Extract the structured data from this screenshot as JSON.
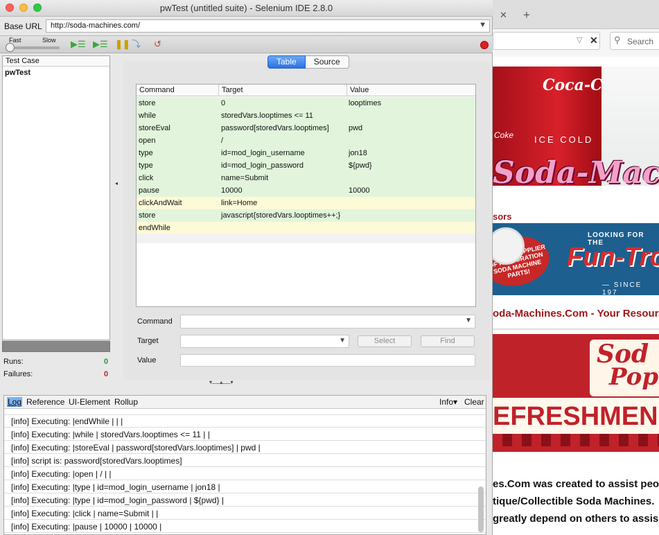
{
  "window": {
    "title": "pwTest (untitled suite) - Selenium IDE 2.8.0"
  },
  "base_url": {
    "label": "Base URL",
    "value": "http://soda-machines.com/"
  },
  "speed": {
    "fast_label": "Fast",
    "slow_label": "Slow"
  },
  "test_case_panel": {
    "header": "Test Case",
    "items": [
      "pwTest"
    ]
  },
  "stats": {
    "runs_label": "Runs:",
    "runs_value": "0",
    "failures_label": "Failures:",
    "failures_value": "0"
  },
  "tabs": {
    "table": "Table",
    "source": "Source"
  },
  "grid": {
    "headers": [
      "Command",
      "Target",
      "Value"
    ],
    "rows": [
      {
        "command": "store",
        "target": "0",
        "value": "looptimes"
      },
      {
        "command": "while",
        "target": "storedVars.looptimes <= 11",
        "value": ""
      },
      {
        "command": "storeEval",
        "target": "password[storedVars.looptimes]",
        "value": "pwd"
      },
      {
        "command": "open",
        "target": "/",
        "value": ""
      },
      {
        "command": "type",
        "target": "id=mod_login_username",
        "value": "jon18"
      },
      {
        "command": "type",
        "target": "id=mod_login_password",
        "value": "${pwd}"
      },
      {
        "command": "click",
        "target": "name=Submit",
        "value": ""
      },
      {
        "command": "pause",
        "target": "10000",
        "value": "10000"
      },
      {
        "command": "clickAndWait",
        "target": "link=Home",
        "value": ""
      },
      {
        "command": "store",
        "target": "javascript{storedVars.looptimes++;}",
        "value": ""
      },
      {
        "command": "endWhile",
        "target": "",
        "value": ""
      }
    ]
  },
  "form": {
    "command_label": "Command",
    "target_label": "Target",
    "value_label": "Value",
    "select_button": "Select",
    "find_button": "Find"
  },
  "log": {
    "tabs": [
      "Log",
      "Reference",
      "UI-Element",
      "Rollup"
    ],
    "info_label": "Info▾",
    "clear_label": "Clear",
    "lines": [
      "[info] Executing: |endWhile | | |",
      "[info] Executing: |while | storedVars.looptimes <= 11 | |",
      "[info] Executing: |storeEval | password[storedVars.looptimes] | pwd |",
      "[info] script is: password[storedVars.looptimes]",
      "[info] Executing: |open | / | |",
      "[info] Executing: |type | id=mod_login_username | jon18 |",
      "[info] Executing: |type | id=mod_login_password | ${pwd} |",
      "[info] Executing: |click | name=Submit | |",
      "[info] Executing: |pause | 10000 | 10000 |"
    ]
  },
  "browser": {
    "search_placeholder": "Search",
    "ad_top_brand": "Coca-Cola",
    "ad_top_icecold": "ICE COLD",
    "ad_top_coke": "Coke",
    "ad_top_title": "Soda-Mach",
    "sponsors_label": "sors",
    "ad2_looking": "LOOKING FOR THE",
    "ad2_brand": "Fun-Tron",
    "ad2_since": "— SINCE 197",
    "ad2_badge": "LARGEST SUPPLIER OF RESTORATION SODA MACHINE PARTS!",
    "slogan": "oda-Machines.Com - Your Resour",
    "ad3_soda": "Sod",
    "ad3_pop": "Pop",
    "ad3_refresh": "EFRESHMEN",
    "body_lines": [
      "es.Com was created to assist peo",
      "tique/Collectible Soda Machines.",
      "greatly depend on others to assis"
    ]
  },
  "colors": {
    "row_green": "#e2f5dc",
    "row_yellow": "#fdfad8",
    "accent_blue": "#2a72e2",
    "runs_green": "#2a9a2a",
    "failures_red": "#c02020"
  }
}
